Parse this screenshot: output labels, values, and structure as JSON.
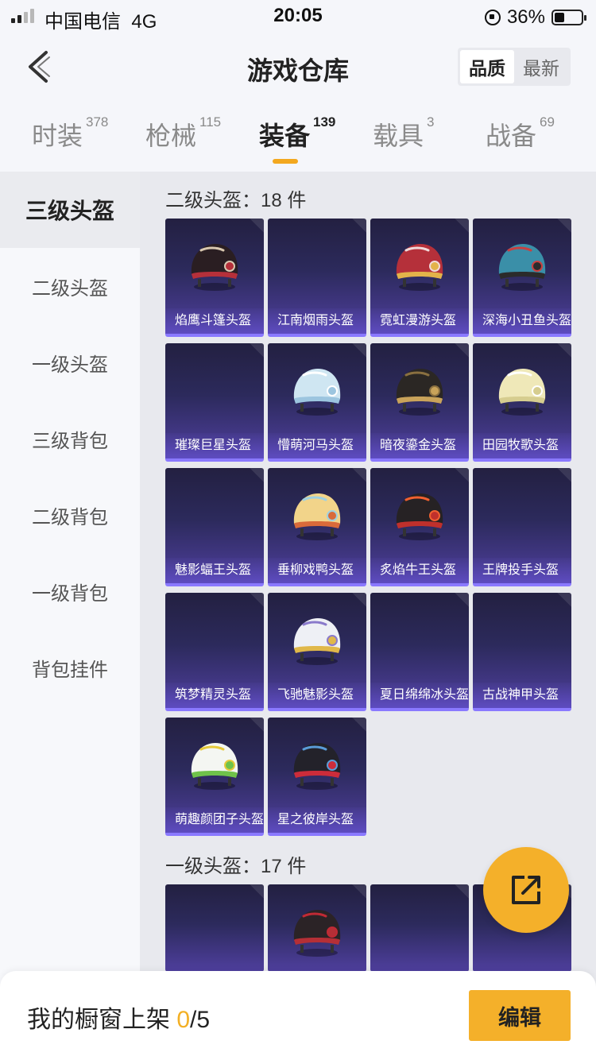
{
  "status_bar": {
    "carrier": "中国电信",
    "network": "4G",
    "time": "20:05",
    "battery": "36%"
  },
  "header": {
    "title": "游戏仓库",
    "sort_options": [
      "品质",
      "最新"
    ],
    "active_sort": "品质"
  },
  "tabs": [
    {
      "label": "时装",
      "count": "378"
    },
    {
      "label": "枪械",
      "count": "115"
    },
    {
      "label": "装备",
      "count": "139"
    },
    {
      "label": "载具",
      "count": "3"
    },
    {
      "label": "战备",
      "count": "69"
    }
  ],
  "active_tab": "装备",
  "sidebar": {
    "items": [
      "三级头盔",
      "二级头盔",
      "一级头盔",
      "三级背包",
      "二级背包",
      "一级背包",
      "背包挂件"
    ],
    "active": "三级头盔"
  },
  "sections": [
    {
      "title": "二级头盔：18 件",
      "items": [
        {
          "name": "焰鹰斗篷头盔",
          "icon": "helmet-black-red"
        },
        {
          "name": "江南烟雨头盔",
          "icon": ""
        },
        {
          "name": "霓虹漫游头盔",
          "icon": "helmet-red-gold"
        },
        {
          "name": "深海小丑鱼头盔",
          "icon": "helmet-teal"
        },
        {
          "name": "璀璨巨星头盔",
          "icon": ""
        },
        {
          "name": "懵萌河马头盔",
          "icon": "helmet-hippo"
        },
        {
          "name": "暗夜鎏金头盔",
          "icon": "helmet-black-gold"
        },
        {
          "name": "田园牧歌头盔",
          "icon": "helmet-cream"
        },
        {
          "name": "魅影蝠王头盔",
          "icon": ""
        },
        {
          "name": "垂柳戏鸭头盔",
          "icon": "helmet-duck"
        },
        {
          "name": "炙焰牛王头盔",
          "icon": "helmet-flame"
        },
        {
          "name": "王牌投手头盔",
          "icon": ""
        },
        {
          "name": "筑梦精灵头盔",
          "icon": ""
        },
        {
          "name": "飞驰魅影头盔",
          "icon": "helmet-white-gold"
        },
        {
          "name": "夏日绵绵冰头盔",
          "icon": ""
        },
        {
          "name": "古战神甲头盔",
          "icon": ""
        },
        {
          "name": "萌趣颜团子头盔",
          "icon": "helmet-green-white"
        },
        {
          "name": "星之彼岸头盔",
          "icon": "helmet-black-red-visor"
        }
      ]
    },
    {
      "title": "一级头盔：17 件",
      "items": [
        {
          "name": "",
          "icon": ""
        },
        {
          "name": "",
          "icon": "helmet-black-red-face"
        },
        {
          "name": "",
          "icon": ""
        },
        {
          "name": "",
          "icon": ""
        }
      ]
    }
  ],
  "bottom_bar": {
    "label": "我的橱窗上架 ",
    "shown": "0",
    "total": "/5",
    "edit_label": "编辑"
  },
  "colors": {
    "accent": "#f4b02a",
    "card_bg": "#2c2a5c",
    "card_border": "#8a79ff"
  }
}
